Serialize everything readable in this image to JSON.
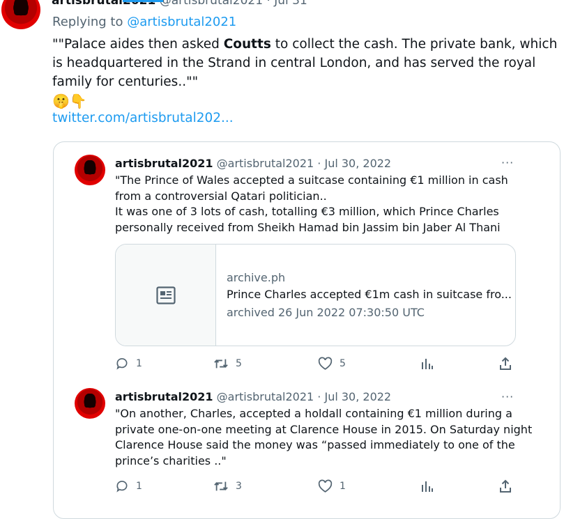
{
  "top": {
    "name": "artisbrutal2021",
    "handle_date": "@artisbrutal2021 · Jul 31"
  },
  "main_tweet": {
    "replying_prefix": "Replying to",
    "replying_handle": "@artisbrutal2021",
    "text_before": "\"\"Palace aides then asked ",
    "text_bold": "Coutts",
    "text_after": " to collect the cash. The private bank, which is headquartered in the Strand in central London, and has served the royal family for centuries..\"\"",
    "emoji": "🤫👇",
    "link": "twitter.com/artisbrutal202..."
  },
  "quote1": {
    "name": "artisbrutal2021",
    "handle": "@artisbrutal2021",
    "date": "· Jul 30, 2022",
    "text_lines": [
      "\"The Prince of Wales accepted a suitcase containing €1 million in cash",
      "from a controversial Qatari politician..",
      "It was one of 3 lots of cash, totalling €3 million, which Prince Charles",
      "personally received from Sheikh Hamad bin Jassim bin Jaber Al Thani"
    ],
    "link_card": {
      "domain": "archive.ph",
      "title": "Prince Charles accepted €1m cash in suitcase fro...",
      "subtitle": "archived 26 Jun 2022 07:30:50 UTC"
    },
    "replies": "1",
    "retweets": "5",
    "likes": "5"
  },
  "quote2": {
    "name": "artisbrutal2021",
    "handle": "@artisbrutal2021",
    "date": "· Jul 30, 2022",
    "text_lines": [
      "\"On another, Charles, accepted a holdall containing €1 million during a",
      "private one-on-one meeting at Clarence House in 2015. On Saturday night",
      "Clarence House said the money was “passed immediately to one of the",
      "prince’s charities ..\""
    ],
    "replies": "1",
    "retweets": "3",
    "likes": "1"
  },
  "more_label": "···",
  "icons": {
    "reply": "reply-icon",
    "retweet": "retweet-icon",
    "like": "heart-icon",
    "views": "analytics-icon",
    "share": "share-icon",
    "article": "article-icon"
  },
  "colors": {
    "accent": "#1d9bf0",
    "muted": "#536471",
    "text": "#0f1419",
    "border": "#cfd9de"
  }
}
